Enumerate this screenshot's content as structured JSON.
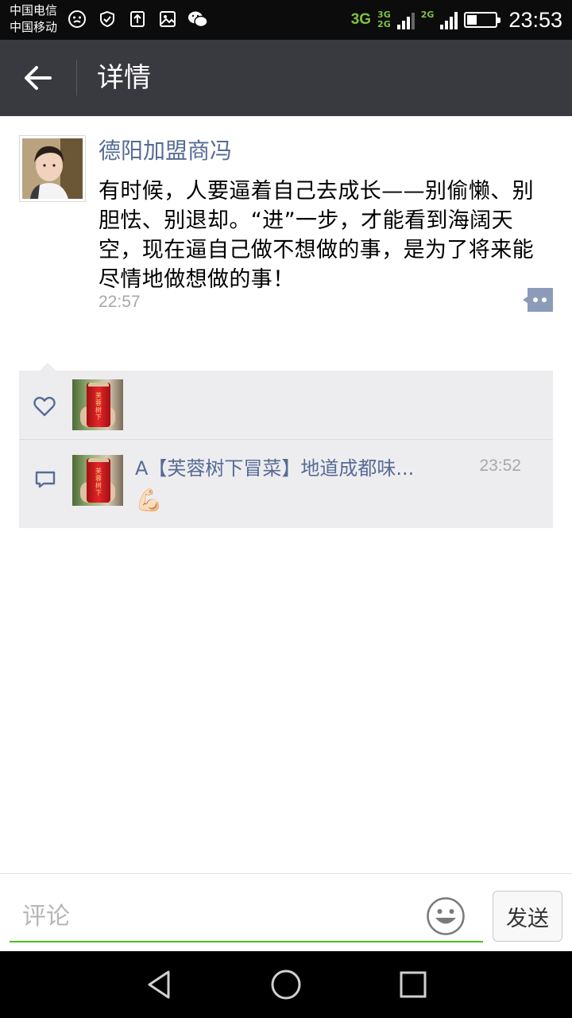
{
  "status_bar": {
    "carrier_1": "中国电信",
    "carrier_2": "中国移动",
    "net_primary": "3G",
    "net_secondary_top": "3G",
    "net_secondary_bottom": "2G",
    "net_third": "2G",
    "time": "23:53",
    "battery_level": 0.35,
    "icons": [
      "face-icon",
      "shield-check-icon",
      "upload-icon",
      "image-icon",
      "wechat-icon"
    ]
  },
  "header": {
    "title": "详情",
    "back_icon": "arrow-left-icon"
  },
  "post": {
    "author": "德阳加盟商冯",
    "text": "有时候，人要逼着自己去成长——别偷懒、别胆怯、别退却。“进”一步，才能看到海阔天空，现在逼自己做不想做的事，是为了将来能尽情地做想做的事！",
    "time": "22:57",
    "more_icon": "comment-more-icon"
  },
  "interactions": {
    "like_icon": "heart-icon",
    "comment_icon": "comment-icon",
    "can_label": "芙蓉树下",
    "comments": [
      {
        "author": "A【芙蓉树下冒菜】地道成都味...",
        "time": "23:52",
        "content": "💪🏻"
      }
    ]
  },
  "input": {
    "placeholder": "评论",
    "send_label": "发送",
    "emoji_icon": "smiley-icon"
  },
  "nav": {
    "icons": [
      "back-triangle-icon",
      "home-circle-icon",
      "recents-square-icon"
    ]
  },
  "colors": {
    "header_bg": "#393a3f",
    "name_link": "#576b95",
    "accent_green": "#45c01a",
    "comment_bg": "#ededf0"
  }
}
